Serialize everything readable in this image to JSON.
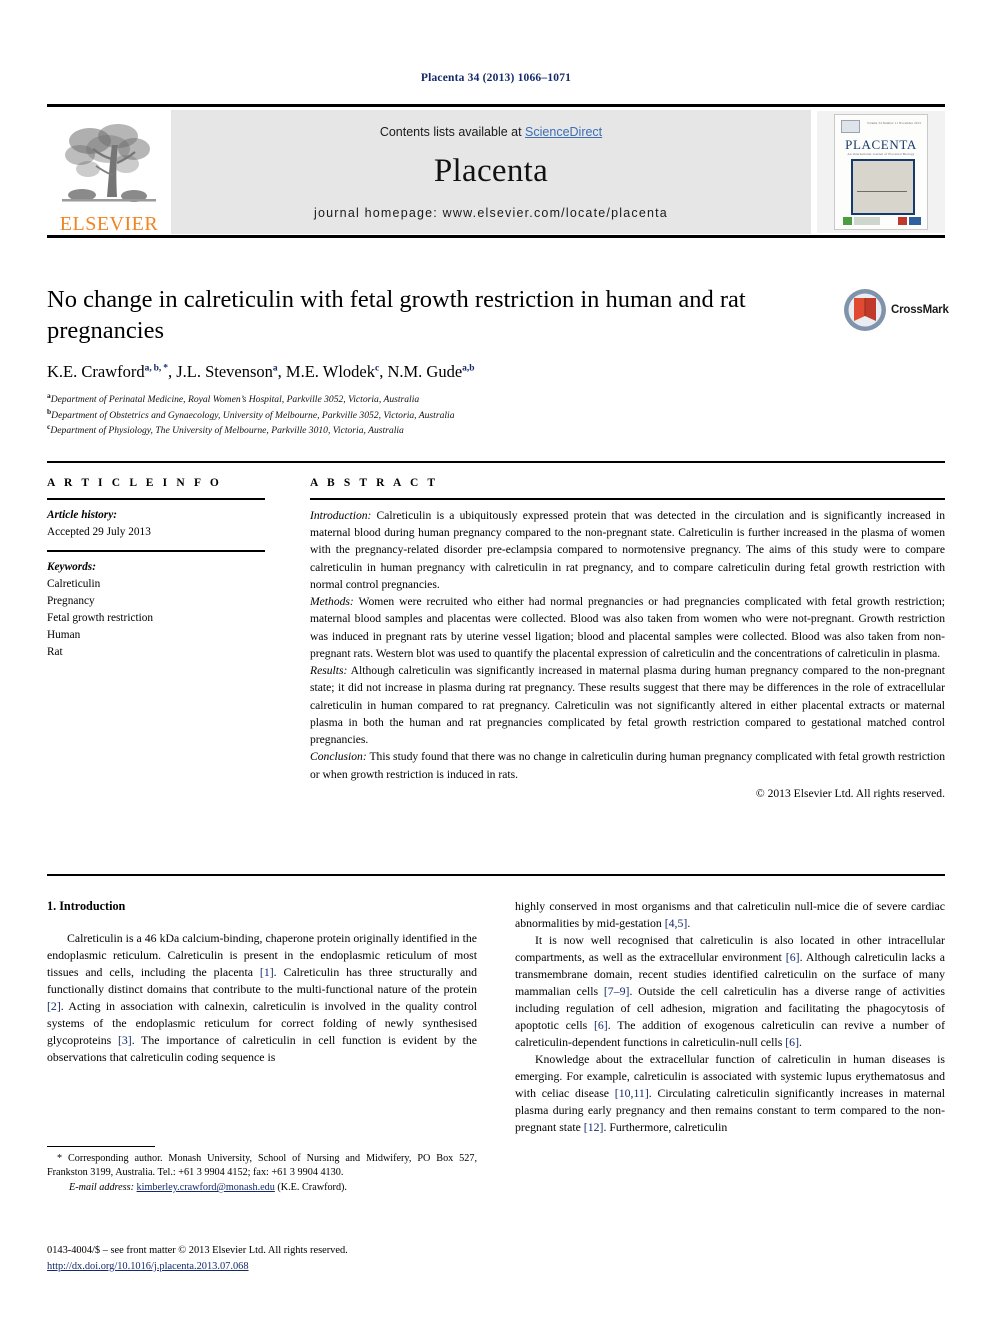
{
  "running_head": "Placenta 34 (2013) 1066–1071",
  "masthead": {
    "contents_prefix": "Contents lists available at ",
    "sciencedirect": "ScienceDirect",
    "journal_name": "Placenta",
    "homepage": "journal homepage: www.elsevier.com/locate/placenta",
    "publisher_logo_text": "ELSEVIER",
    "publisher_logo_icon": "elsevier-tree-icon",
    "cover": {
      "title": "PLACENTA",
      "subtitle": "An International Journal of Placental Biology",
      "issue_text": "Volume 34  Number 11  November 2013"
    }
  },
  "article": {
    "title": "No change in calreticulin with fetal growth restriction in human and rat pregnancies",
    "authors_html": "K.E. Crawford<sup>a, b, *</sup>, J.L. Stevenson<sup>a</sup>, M.E. Wlodek<sup>c</sup>, N.M. Gude<sup>a,b</sup>",
    "affiliations": [
      {
        "mark": "a",
        "text": "Department of Perinatal Medicine, Royal Women’s Hospital, Parkville 3052, Victoria, Australia"
      },
      {
        "mark": "b",
        "text": "Department of Obstetrics and Gynaecology, University of Melbourne, Parkville 3052, Victoria, Australia"
      },
      {
        "mark": "c",
        "text": "Department of Physiology, The University of Melbourne, Parkville 3010, Victoria, Australia"
      }
    ],
    "crossmark_label": "CrossMark",
    "crossmark_icon": "crossmark-badge-icon"
  },
  "article_info": {
    "heading": "A R T I C L E  I N F O",
    "history_label": "Article history:",
    "history_value": "Accepted 29 July 2013",
    "keywords_label": "Keywords:",
    "keywords": [
      "Calreticulin",
      "Pregnancy",
      "Fetal growth restriction",
      "Human",
      "Rat"
    ]
  },
  "abstract": {
    "heading": "A B S T R A C T",
    "sections": [
      {
        "label": "Introduction:",
        "text": " Calreticulin is a ubiquitously expressed protein that was detected in the circulation and is significantly increased in maternal blood during human pregnancy compared to the non-pregnant state. Calreticulin is further increased in the plasma of women with the pregnancy-related disorder pre-eclampsia compared to normotensive pregnancy. The aims of this study were to compare calreticulin in human pregnancy with calreticulin in rat pregnancy, and to compare calreticulin during fetal growth restriction with normal control pregnancies."
      },
      {
        "label": "Methods:",
        "text": " Women were recruited who either had normal pregnancies or had pregnancies complicated with fetal growth restriction; maternal blood samples and placentas were collected. Blood was also taken from women who were not-pregnant. Growth restriction was induced in pregnant rats by uterine vessel ligation; blood and placental samples were collected. Blood was also taken from non-pregnant rats. Western blot was used to quantify the placental expression of calreticulin and the concentrations of calreticulin in plasma."
      },
      {
        "label": "Results:",
        "text": " Although calreticulin was significantly increased in maternal plasma during human pregnancy compared to the non-pregnant state; it did not increase in plasma during rat pregnancy. These results suggest that there may be differences in the role of extracellular calreticulin in human compared to rat pregnancy. Calreticulin was not significantly altered in either placental extracts or maternal plasma in both the human and rat pregnancies complicated by fetal growth restriction compared to gestational matched control pregnancies."
      },
      {
        "label": "Conclusion:",
        "text": " This study found that there was no change in calreticulin during human pregnancy complicated with fetal growth restriction or when growth restriction is induced in rats."
      }
    ],
    "copyright": "© 2013 Elsevier Ltd. All rights reserved."
  },
  "body": {
    "section_heading": "1. Introduction",
    "left_paragraphs": [
      "Calreticulin is a 46 kDa calcium-binding, chaperone protein originally identified in the endoplasmic reticulum. Calreticulin is present in the endoplasmic reticulum of most tissues and cells, including the placenta [1]. Calreticulin has three structurally and functionally distinct domains that contribute to the multi-functional nature of the protein [2]. Acting in association with calnexin, calreticulin is involved in the quality control systems of the endoplasmic reticulum for correct folding of newly synthesised glycoproteins [3]. The importance of calreticulin in cell function is evident by the observations that calreticulin coding sequence is"
    ],
    "right_paragraphs": [
      "highly conserved in most organisms and that calreticulin null-mice die of severe cardiac abnormalities by mid-gestation [4,5].",
      "It is now well recognised that calreticulin is also located in other intracellular compartments, as well as the extracellular environment [6]. Although calreticulin lacks a transmembrane domain, recent studies identified calreticulin on the surface of many mammalian cells [7–9]. Outside the cell calreticulin has a diverse range of activities including regulation of cell adhesion, migration and facilitating the phagocytosis of apoptotic cells [6]. The addition of exogenous calreticulin can revive a number of calreticulin-dependent functions in calreticulin-null cells [6].",
      "Knowledge about the extracellular function of calreticulin in human diseases is emerging. For example, calreticulin is associated with systemic lupus erythematosus and with celiac disease [10,11]. Circulating calreticulin significantly increases in maternal plasma during early pregnancy and then remains constant to term compared to the non-pregnant state [12]. Furthermore, calreticulin"
    ]
  },
  "footnotes": {
    "corresponding": "* Corresponding author. Monash University, School of Nursing and Midwifery, PO Box 527, Frankston 3199, Australia. Tel.: +61 3 9904 4152; fax: +61 3 9904 4130.",
    "email_label": "E-mail address:",
    "email": "kimberley.crawford@monash.edu",
    "email_suffix": " (K.E. Crawford).",
    "imprint": "0143-4004/$ – see front matter © 2013 Elsevier Ltd. All rights reserved.",
    "doi": "http://dx.doi.org/10.1016/j.placenta.2013.07.068"
  },
  "colors": {
    "link_blue": "#14296b",
    "sciencedirect_blue": "#3b6fb6",
    "elsevier_orange": "#f08421",
    "band_gray": "#e6e6e6"
  }
}
